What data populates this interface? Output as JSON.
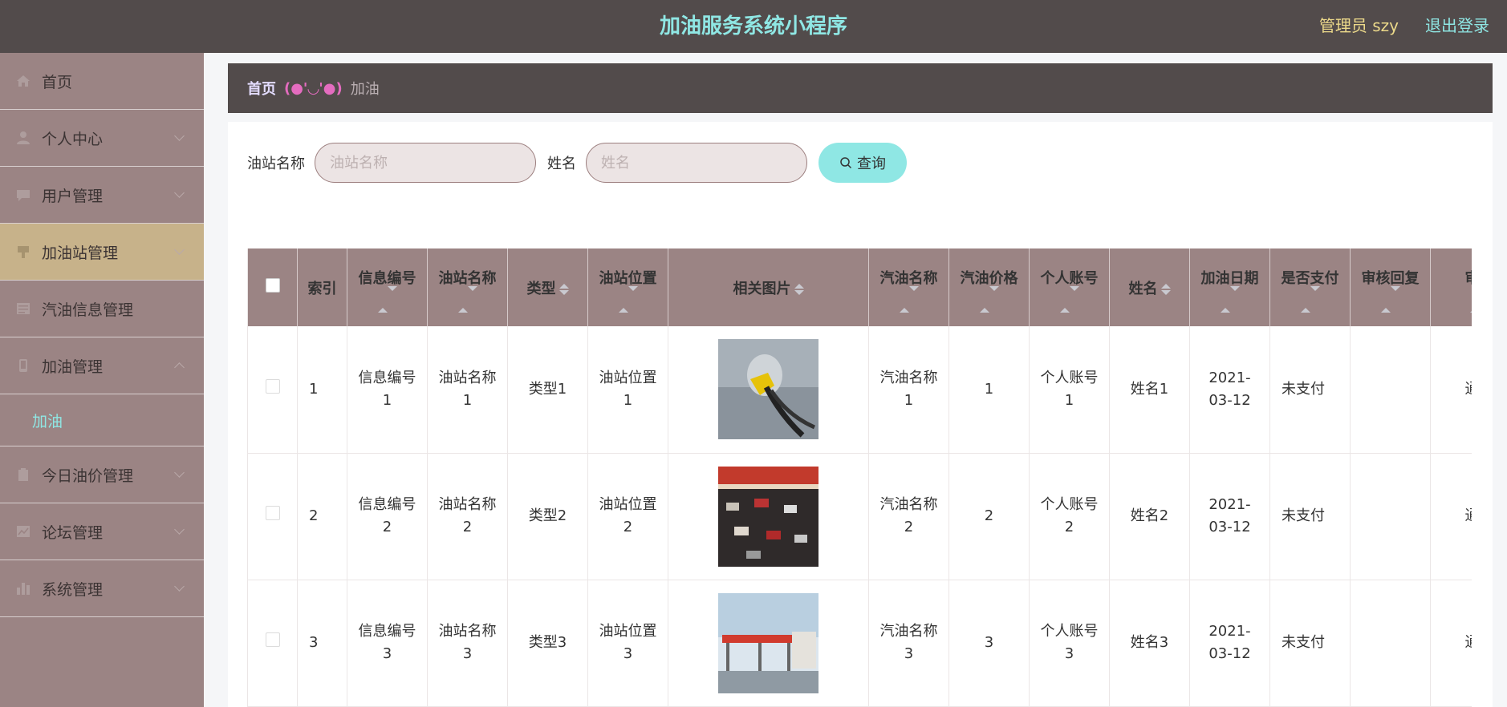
{
  "header": {
    "title": "加油服务系统小程序",
    "admin_label": "管理员 szy",
    "logout_label": "退出登录"
  },
  "sidebar": {
    "items": [
      {
        "label": "首页",
        "icon": "home-icon"
      },
      {
        "label": "个人中心",
        "icon": "user-icon"
      },
      {
        "label": "用户管理",
        "icon": "chat-icon"
      },
      {
        "label": "加油站管理",
        "icon": "station-icon"
      },
      {
        "label": "汽油信息管理",
        "icon": "list-icon"
      },
      {
        "label": "加油管理",
        "icon": "phone-icon",
        "submenu": [
          "加油"
        ]
      },
      {
        "label": "今日油价管理",
        "icon": "clipboard-icon"
      },
      {
        "label": "论坛管理",
        "icon": "chart-icon"
      },
      {
        "label": "系统管理",
        "icon": "bars-icon"
      }
    ]
  },
  "breadcrumb": {
    "home": "首页",
    "separator": "(●'◡'●)",
    "current": "加油"
  },
  "search": {
    "station_label": "油站名称",
    "station_placeholder": "油站名称",
    "station_value": "",
    "name_label": "姓名",
    "name_placeholder": "姓名",
    "name_value": "",
    "button_label": "查询"
  },
  "table": {
    "columns": [
      "索引",
      "信息编号",
      "油站名称",
      "类型",
      "油站位置",
      "相关图片",
      "汽油名称",
      "汽油价格",
      "个人账号",
      "姓名",
      "加油日期",
      "是否支付",
      "审核回复",
      "审核"
    ],
    "rows": [
      {
        "index": "1",
        "info_no": "信息编号1",
        "station": "油站名称1",
        "type": "类型1",
        "location": "油站位置1",
        "image": "fuel-nozzle-photo",
        "gas_name": "汽油名称1",
        "price": "1",
        "account": "个人账号1",
        "name": "姓名1",
        "date": "2021-03-12",
        "paid": "未支付",
        "reply": "",
        "review": "通过"
      },
      {
        "index": "2",
        "info_no": "信息编号2",
        "station": "油站名称2",
        "type": "类型2",
        "location": "油站位置2",
        "image": "night-station-photo",
        "gas_name": "汽油名称2",
        "price": "2",
        "account": "个人账号2",
        "name": "姓名2",
        "date": "2021-03-12",
        "paid": "未支付",
        "reply": "",
        "review": "通过"
      },
      {
        "index": "3",
        "info_no": "信息编号3",
        "station": "油站名称3",
        "type": "类型3",
        "location": "油站位置3",
        "image": "station-exterior-photo",
        "gas_name": "汽油名称3",
        "price": "3",
        "account": "个人账号3",
        "name": "姓名3",
        "date": "2021-03-12",
        "paid": "未支付",
        "reply": "",
        "review": "通过"
      }
    ]
  },
  "colors": {
    "topbar": "#524b4b",
    "title": "#8fe7e4",
    "admin": "#ecd98a",
    "sidebar": "#9b8484",
    "active_menu": "#c7b28a",
    "search_button": "#8fe7e4",
    "table_header": "#9b8484"
  }
}
